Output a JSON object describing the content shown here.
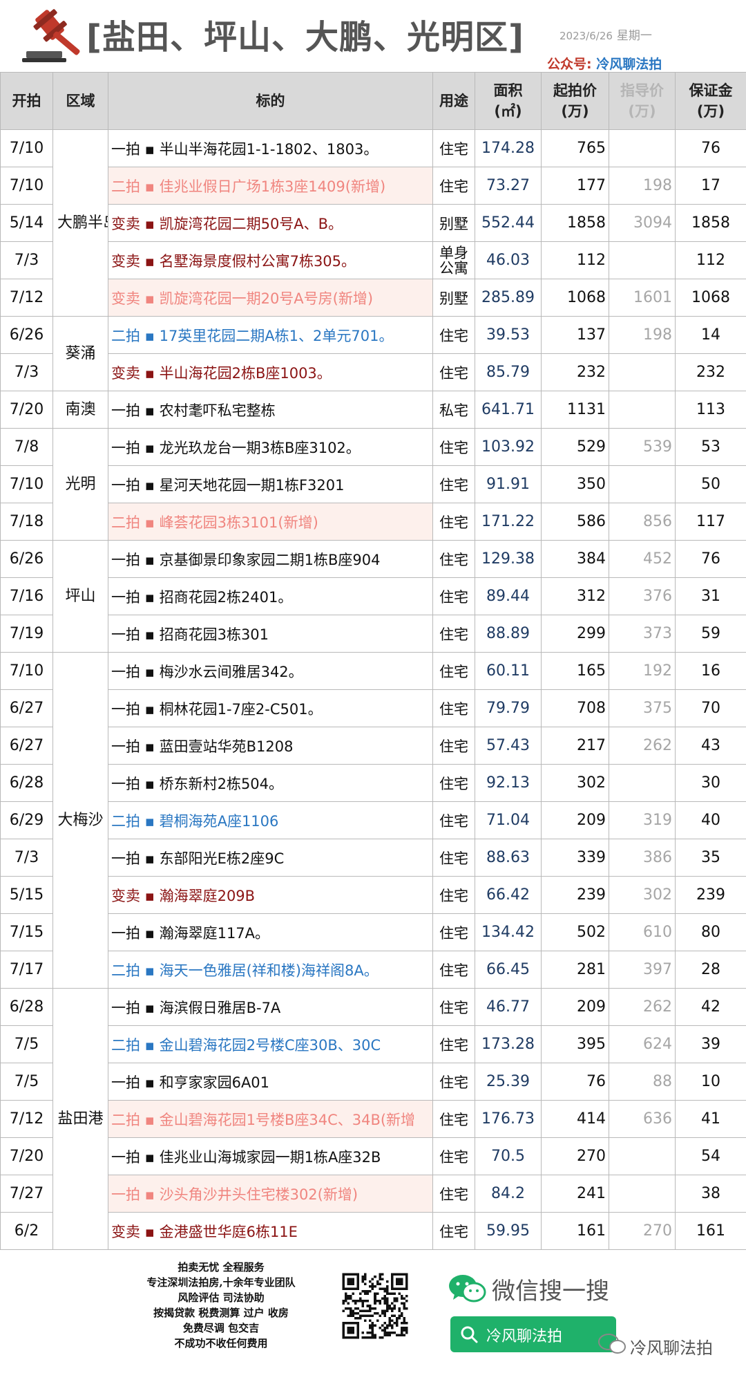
{
  "header": {
    "title": "[盐田、坪山、大鹏、光明区]",
    "date": "2023/6/26",
    "weekday": "星期一",
    "account_label": "公众号:",
    "account_name": "冷风聊法拍"
  },
  "table": {
    "columns": [
      "开拍",
      "区域",
      "标的",
      "用途",
      "面积\n(㎡)",
      "起拍价\n(万)",
      "指导价\n(万)",
      "保证金\n(万)"
    ],
    "regions": [
      {
        "name": "大鹏半岛",
        "rows": 5
      },
      {
        "name": "葵涌",
        "rows": 2
      },
      {
        "name": "南澳",
        "rows": 1
      },
      {
        "name": "光明",
        "rows": 3
      },
      {
        "name": "坪山",
        "rows": 3
      },
      {
        "name": "大梅沙",
        "rows": 9
      },
      {
        "name": "盐田港",
        "rows": 7
      }
    ],
    "rows": [
      {
        "date": "7/10",
        "item": "一拍 ▪ 半山半海花园1-1-1802、1803。",
        "color": "black",
        "hl": false,
        "use": "住宅",
        "area": "174.28",
        "start": "765",
        "guide": "",
        "deposit": "76"
      },
      {
        "date": "7/10",
        "item": "二拍 ▪ 佳兆业假日广场1栋3座1409(新增)",
        "color": "pink",
        "hl": true,
        "use": "住宅",
        "area": "73.27",
        "start": "177",
        "guide": "198",
        "deposit": "17"
      },
      {
        "date": "5/14",
        "item": "变卖 ▪ 凯旋湾花园二期50号A、B。",
        "color": "red",
        "hl": false,
        "use": "别墅",
        "area": "552.44",
        "start": "1858",
        "guide": "3094",
        "deposit": "1858"
      },
      {
        "date": "7/3",
        "item": "变卖 ▪ 名墅海景度假村公寓7栋305。",
        "color": "red",
        "hl": false,
        "use": "单身公寓",
        "area": "46.03",
        "start": "112",
        "guide": "",
        "deposit": "112"
      },
      {
        "date": "7/12",
        "item": "变卖 ▪ 凯旋湾花园一期20号A号房(新增)",
        "color": "pink",
        "hl": true,
        "use": "别墅",
        "area": "285.89",
        "start": "1068",
        "guide": "1601",
        "deposit": "1068"
      },
      {
        "date": "6/26",
        "item": "二拍 ▪ 17英里花园二期A栋1、2单元701。",
        "color": "blue",
        "hl": false,
        "use": "住宅",
        "area": "39.53",
        "start": "137",
        "guide": "198",
        "deposit": "14"
      },
      {
        "date": "7/3",
        "item": "变卖 ▪ 半山海花园2栋B座1003。",
        "color": "red",
        "hl": false,
        "use": "住宅",
        "area": "85.79",
        "start": "232",
        "guide": "",
        "deposit": "232"
      },
      {
        "date": "7/20",
        "item": "一拍 ▪ 农村耄吓私宅整栋",
        "color": "black",
        "hl": false,
        "use": "私宅",
        "area": "641.71",
        "start": "1131",
        "guide": "",
        "deposit": "113"
      },
      {
        "date": "7/8",
        "item": "一拍 ▪ 龙光玖龙台一期3栋B座3102。",
        "color": "black",
        "hl": false,
        "use": "住宅",
        "area": "103.92",
        "start": "529",
        "guide": "539",
        "deposit": "53"
      },
      {
        "date": "7/10",
        "item": "一拍 ▪ 星河天地花园一期1栋F3201",
        "color": "black",
        "hl": false,
        "use": "住宅",
        "area": "91.91",
        "start": "350",
        "guide": "",
        "deposit": "50"
      },
      {
        "date": "7/18",
        "item": "二拍 ▪ 峰荟花园3栋3101(新增)",
        "color": "pink",
        "hl": true,
        "use": "住宅",
        "area": "171.22",
        "start": "586",
        "guide": "856",
        "deposit": "117"
      },
      {
        "date": "6/26",
        "item": "一拍 ▪ 京基御景印象家园二期1栋B座904",
        "color": "black",
        "hl": false,
        "use": "住宅",
        "area": "129.38",
        "start": "384",
        "guide": "452",
        "deposit": "76"
      },
      {
        "date": "7/16",
        "item": "一拍 ▪ 招商花园2栋2401。",
        "color": "black",
        "hl": false,
        "use": "住宅",
        "area": "89.44",
        "start": "312",
        "guide": "376",
        "deposit": "31"
      },
      {
        "date": "7/19",
        "item": "一拍 ▪ 招商花园3栋301",
        "color": "black",
        "hl": false,
        "use": "住宅",
        "area": "88.89",
        "start": "299",
        "guide": "373",
        "deposit": "59"
      },
      {
        "date": "7/10",
        "item": "一拍 ▪ 梅沙水云间雅居342。",
        "color": "black",
        "hl": false,
        "use": "住宅",
        "area": "60.11",
        "start": "165",
        "guide": "192",
        "deposit": "16"
      },
      {
        "date": "6/27",
        "item": "一拍 ▪ 桐林花园1-7座2-C501。",
        "color": "black",
        "hl": false,
        "use": "住宅",
        "area": "79.79",
        "start": "708",
        "guide": "375",
        "deposit": "70"
      },
      {
        "date": "6/27",
        "item": "一拍 ▪ 蓝田壹站华苑B1208",
        "color": "black",
        "hl": false,
        "use": "住宅",
        "area": "57.43",
        "start": "217",
        "guide": "262",
        "deposit": "43"
      },
      {
        "date": "6/28",
        "item": "一拍 ▪ 桥东新村2栋504。",
        "color": "black",
        "hl": false,
        "use": "住宅",
        "area": "92.13",
        "start": "302",
        "guide": "",
        "deposit": "30"
      },
      {
        "date": "6/29",
        "item": "二拍 ▪ 碧桐海苑A座1106",
        "color": "blue",
        "hl": false,
        "use": "住宅",
        "area": "71.04",
        "start": "209",
        "guide": "319",
        "deposit": "40"
      },
      {
        "date": "7/3",
        "item": "一拍 ▪ 东部阳光E栋2座9C",
        "color": "black",
        "hl": false,
        "use": "住宅",
        "area": "88.63",
        "start": "339",
        "guide": "386",
        "deposit": "35"
      },
      {
        "date": "5/15",
        "item": "变卖 ▪ 瀚海翠庭209B",
        "color": "red",
        "hl": false,
        "use": "住宅",
        "area": "66.42",
        "start": "239",
        "guide": "302",
        "deposit": "239"
      },
      {
        "date": "7/15",
        "item": "一拍 ▪ 瀚海翠庭117A。",
        "color": "black",
        "hl": false,
        "use": "住宅",
        "area": "134.42",
        "start": "502",
        "guide": "610",
        "deposit": "80"
      },
      {
        "date": "7/17",
        "item": "二拍 ▪ 海天一色雅居(祥和楼)海祥阁8A。",
        "color": "blue",
        "hl": false,
        "use": "住宅",
        "area": "66.45",
        "start": "281",
        "guide": "397",
        "deposit": "28"
      },
      {
        "date": "6/28",
        "item": "一拍 ▪ 海滨假日雅居B-7A",
        "color": "black",
        "hl": false,
        "use": "住宅",
        "area": "46.77",
        "start": "209",
        "guide": "262",
        "deposit": "42"
      },
      {
        "date": "7/5",
        "item": "二拍 ▪ 金山碧海花园2号楼C座30B、30C",
        "color": "blue",
        "hl": false,
        "use": "住宅",
        "area": "173.28",
        "start": "395",
        "guide": "624",
        "deposit": "39"
      },
      {
        "date": "7/5",
        "item": "一拍 ▪ 和亨家家园6A01",
        "color": "black",
        "hl": false,
        "use": "住宅",
        "area": "25.39",
        "start": "76",
        "guide": "88",
        "deposit": "10"
      },
      {
        "date": "7/12",
        "item": "二拍 ▪ 金山碧海花园1号楼B座34C、34B(新增",
        "color": "pink",
        "hl": true,
        "use": "住宅",
        "area": "176.73",
        "start": "414",
        "guide": "636",
        "deposit": "41"
      },
      {
        "date": "7/20",
        "item": "一拍 ▪ 佳兆业山海城家园一期1栋A座32B",
        "color": "black",
        "hl": false,
        "use": "住宅",
        "area": "70.5",
        "start": "270",
        "guide": "",
        "deposit": "54"
      },
      {
        "date": "7/27",
        "item": "一拍 ▪ 沙头角沙井头住宅楼302(新增)",
        "color": "pink",
        "hl": true,
        "use": "住宅",
        "area": "84.2",
        "start": "241",
        "guide": "",
        "deposit": "38"
      },
      {
        "date": "6/2",
        "item": "变卖 ▪ 金港盛世华庭6栋11E",
        "color": "red",
        "hl": false,
        "use": "住宅",
        "area": "59.95",
        "start": "161",
        "guide": "270",
        "deposit": "161"
      }
    ]
  },
  "footer": {
    "promo_lines": [
      "拍卖无忧 全程服务",
      "专注深圳法拍房,十余年专业团队",
      "风险评估 司法协助",
      "按揭贷款 税费测算 过户 收房",
      "免费尽调 包交吉",
      "不成功不收任何费用"
    ],
    "wechat_search_title": "微信搜一搜",
    "search_button_label": "冷风聊法拍",
    "watermark": "冷风聊法拍",
    "brand_green": "#1fb16a"
  },
  "colors": {
    "header_bg": "#d9d9d9",
    "highlight_bg": "#fdf0ec",
    "text_pink": "#f0857f",
    "text_red": "#8b1414",
    "text_blue": "#2a77c2",
    "guide_gray": "#a6a6a6"
  },
  "icons": {
    "header": "gavel-icon",
    "wechat": "wechat-icon",
    "search": "search-icon",
    "qr": "qr-code"
  }
}
